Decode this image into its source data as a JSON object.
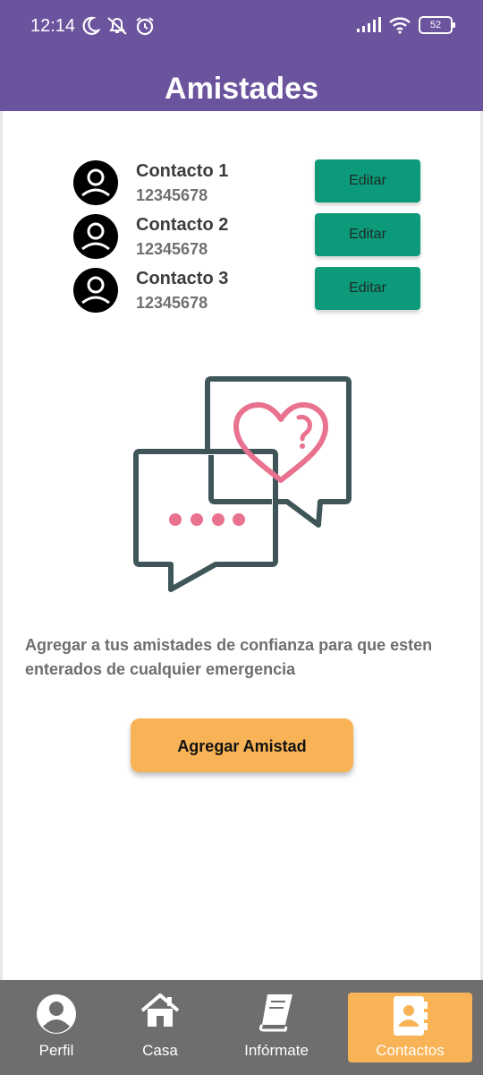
{
  "status_bar": {
    "time": "12:14",
    "battery": "52"
  },
  "header": {
    "title": "Amistades"
  },
  "contacts": [
    {
      "name": "Contacto 1",
      "phone": "12345678",
      "edit_label": "Editar"
    },
    {
      "name": "Contacto 2",
      "phone": "12345678",
      "edit_label": "Editar"
    },
    {
      "name": "Contacto 3",
      "phone": "12345678",
      "edit_label": "Editar"
    }
  ],
  "description": "Agregar a tus amistades de confianza para que esten enterados de cualquier emergencia",
  "add_button": "Agregar Amistad",
  "nav": [
    {
      "label": "Perfil",
      "icon": "person-icon"
    },
    {
      "label": "Casa",
      "icon": "home-icon"
    },
    {
      "label": "Infórmate",
      "icon": "book-icon"
    },
    {
      "label": "Contactos",
      "icon": "contacts-book-icon",
      "active": true
    }
  ],
  "colors": {
    "header": "#6b539e",
    "edit_button": "#0d9a7a",
    "accent": "#f7b355",
    "nav": "#6f6d6d"
  }
}
